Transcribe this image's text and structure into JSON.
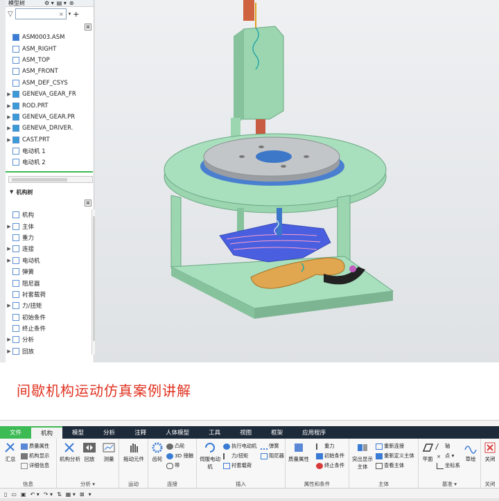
{
  "top_panel": {
    "header_label": "模型树",
    "filter_clear": "×",
    "model_tree": [
      {
        "label": "ASM0003.ASM",
        "arrow": "",
        "icon": "assembly-icon"
      },
      {
        "label": "ASM_RIGHT",
        "arrow": "",
        "icon": "datum-plane-icon"
      },
      {
        "label": "ASM_TOP",
        "arrow": "",
        "icon": "datum-plane-icon"
      },
      {
        "label": "ASM_FRONT",
        "arrow": "",
        "icon": "datum-plane-icon"
      },
      {
        "label": "ASM_DEF_CSYS",
        "arrow": "",
        "icon": "csys-icon"
      },
      {
        "label": "GENEVA_GEAR_FR",
        "arrow": "▶",
        "icon": "part-icon"
      },
      {
        "label": "ROD.PRT",
        "arrow": "▶",
        "icon": "part-icon"
      },
      {
        "label": "GENEVA_GEAR.PR",
        "arrow": "▶",
        "icon": "part-icon"
      },
      {
        "label": "GENEVA_DRIVER.",
        "arrow": "▶",
        "icon": "part-icon"
      },
      {
        "label": "CAST.PRT",
        "arrow": "▶",
        "icon": "part-icon"
      },
      {
        "label": "电动机 1",
        "arrow": "",
        "icon": "motor-icon"
      },
      {
        "label": "电动机 2",
        "arrow": "",
        "icon": "motor-icon"
      }
    ],
    "mechanism_header": "机构树",
    "mechanism_tree": [
      {
        "label": "机构",
        "arrow": "",
        "icon": "mechanism-icon"
      },
      {
        "label": "主体",
        "arrow": "▶",
        "icon": "body-icon"
      },
      {
        "label": "重力",
        "arrow": "",
        "icon": "gravity-icon"
      },
      {
        "label": "连接",
        "arrow": "▶",
        "icon": "connection-icon"
      },
      {
        "label": "电动机",
        "arrow": "▶",
        "icon": "motor-icon"
      },
      {
        "label": "弹簧",
        "arrow": "",
        "icon": "spring-icon"
      },
      {
        "label": "阻尼器",
        "arrow": "",
        "icon": "damper-icon"
      },
      {
        "label": "衬套载荷",
        "arrow": "",
        "icon": "bushing-icon"
      },
      {
        "label": "力/扭矩",
        "arrow": "▶",
        "icon": "force-icon"
      },
      {
        "label": "初始条件",
        "arrow": "",
        "icon": "initial-condition-icon"
      },
      {
        "label": "终止条件",
        "arrow": "",
        "icon": "termination-icon"
      },
      {
        "label": "分析",
        "arrow": "▶",
        "icon": "analysis-icon"
      },
      {
        "label": "回放",
        "arrow": "▶",
        "icon": "playback-icon"
      }
    ]
  },
  "title": "间歇机构运动仿真案例讲解",
  "ribbon": {
    "tabs": [
      {
        "label": "文件",
        "kind": "file"
      },
      {
        "label": "机构",
        "kind": "active"
      },
      {
        "label": "模型",
        "kind": ""
      },
      {
        "label": "分析",
        "kind": ""
      },
      {
        "label": "注释",
        "kind": ""
      },
      {
        "label": "人体模型",
        "kind": ""
      },
      {
        "label": "工具",
        "kind": ""
      },
      {
        "label": "视图",
        "kind": ""
      },
      {
        "label": "框架",
        "kind": ""
      },
      {
        "label": "应用程序",
        "kind": ""
      }
    ],
    "groups": {
      "info": "信息",
      "analysis": "分析 ▾",
      "motion": "运动",
      "connect": "连接",
      "insert": "插入",
      "props": "属性和条件",
      "body": "主体",
      "datum": "基准 ▾",
      "close": "关闭"
    },
    "buttons": {
      "summary": "汇总",
      "mass_props": "质量属性",
      "mech_display": "机构显示",
      "details": "详细信息",
      "mech_analysis": "机构分析",
      "playback": "回放",
      "measure": "测量",
      "drag": "拖动元件",
      "gear": "齿轮",
      "cam": "凸轮",
      "contact3d": "3D 接触",
      "belt": "带",
      "servo": "伺服电动\n机",
      "exec_motor": "执行电动机",
      "force_torque": "力/扭矩",
      "bushing": "衬套载荷",
      "spring": "弹簧",
      "damper": "阻尼器",
      "mass_prop2": "质量属性",
      "gravity": "重力",
      "init_cond": "初始条件",
      "term_cond": "终止条件",
      "highlight_body": "突出显示\n主体",
      "reconnect": "重新连接",
      "redefine_body": "重新定义主体",
      "view_body": "查看主体",
      "plane": "平面",
      "axis": "轴",
      "point": "点 ▾",
      "csys": "坐标系",
      "curve": "草绘",
      "close": "关闭"
    }
  }
}
